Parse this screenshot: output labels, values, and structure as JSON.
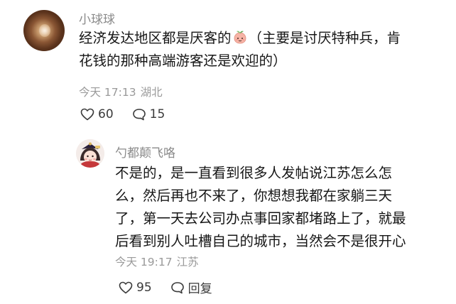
{
  "comment": {
    "username": "小球球",
    "lines": [
      "经济发达地区都是厌客的",
      "（主要是讨厌特种兵，肯",
      "花钱的那种高端游客还是欢迎的）"
    ],
    "emoji_icon": "peach-face-emoji",
    "time": "今天 17:13",
    "location": "湖北",
    "like_count": "60",
    "reply_count": "15"
  },
  "reply": {
    "username": "勺都颠飞咯",
    "lines": [
      "不是的，是一直看到很多人发帖说江苏怎么怎",
      "么，然后再也不来了，你想想我都在家躺三天",
      "了，第一天去公司办点事回家都堵路上了，就最",
      "后看到别人吐槽自己的城市，当然会不是很开心"
    ],
    "time": "今天 19:17",
    "location": "江苏",
    "like_count": "95",
    "reply_label": "回复"
  },
  "icons": {
    "like": "heart-outline-icon",
    "comment": "speech-bubble-icon"
  },
  "colors": {
    "username": "#8a8a8a",
    "meta": "#9a9a9a",
    "text": "#161616"
  }
}
